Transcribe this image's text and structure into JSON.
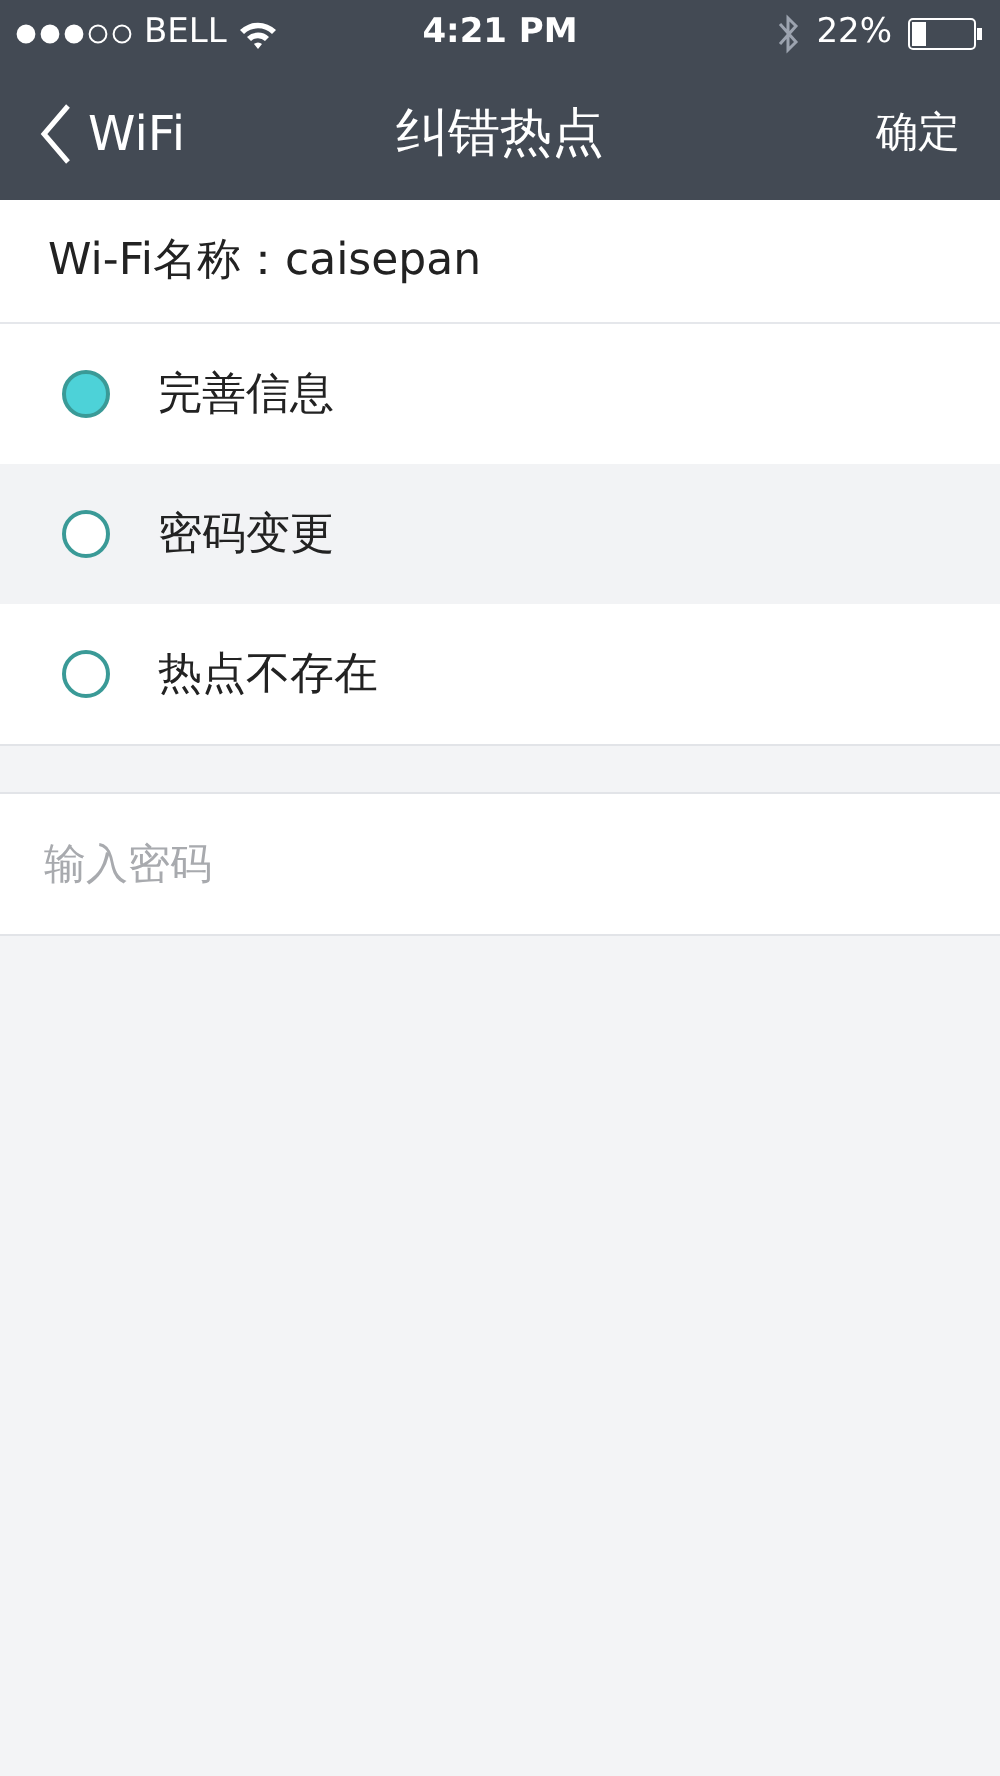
{
  "status_bar": {
    "carrier": "BELL",
    "time": "4:21 PM",
    "battery": "22%"
  },
  "nav_bar": {
    "back": "WiFi",
    "title": "纠错热点",
    "action": "确定"
  },
  "wifi_name": "Wi-Fi名称：caisepan",
  "options": [
    {
      "label": "完善信息",
      "selected": true,
      "highlighted": false
    },
    {
      "label": "密码变更",
      "selected": false,
      "highlighted": true
    },
    {
      "label": "热点不存在",
      "selected": false,
      "highlighted": false
    }
  ],
  "password_field": {
    "placeholder": "输入密码"
  }
}
